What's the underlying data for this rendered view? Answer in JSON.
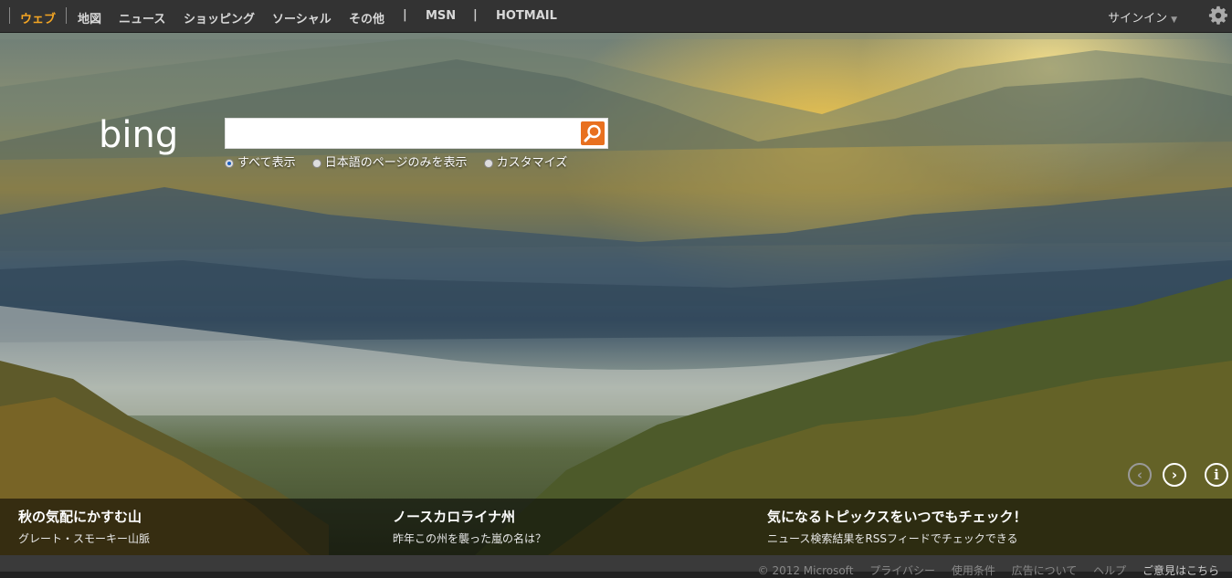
{
  "nav": {
    "items": [
      "ウェブ",
      "地図",
      "ニュース",
      "ショッピング",
      "ソーシャル",
      "その他"
    ],
    "sep": "|",
    "msn": "MSN",
    "hotmail": "HOTMAIL",
    "signin": "サインイン"
  },
  "search": {
    "value": "",
    "options": [
      "すべて表示",
      "日本語のページのみを表示",
      "カスタマイズ"
    ],
    "selected": "すべて表示"
  },
  "logo_text": "bing",
  "captions": [
    {
      "title": "秋の気配にかすむ山",
      "sub": "グレート・スモーキー山脈"
    },
    {
      "title": "ノースカロライナ州",
      "sub": "昨年この州を襲った嵐の名は？"
    },
    {
      "title": "気になるトピックスをいつでもチェック！",
      "sub": "ニュース検索結果をRSSフィードでチェックできる"
    }
  ],
  "footer": {
    "copyright": "© 2012 Microsoft",
    "links": [
      "プライバシー",
      "使用条件",
      "広告について",
      "ヘルプ"
    ],
    "feedback": "ご意見はこちら"
  },
  "colors": {
    "accent": "#f5a623",
    "search_button": "#e8701f"
  }
}
